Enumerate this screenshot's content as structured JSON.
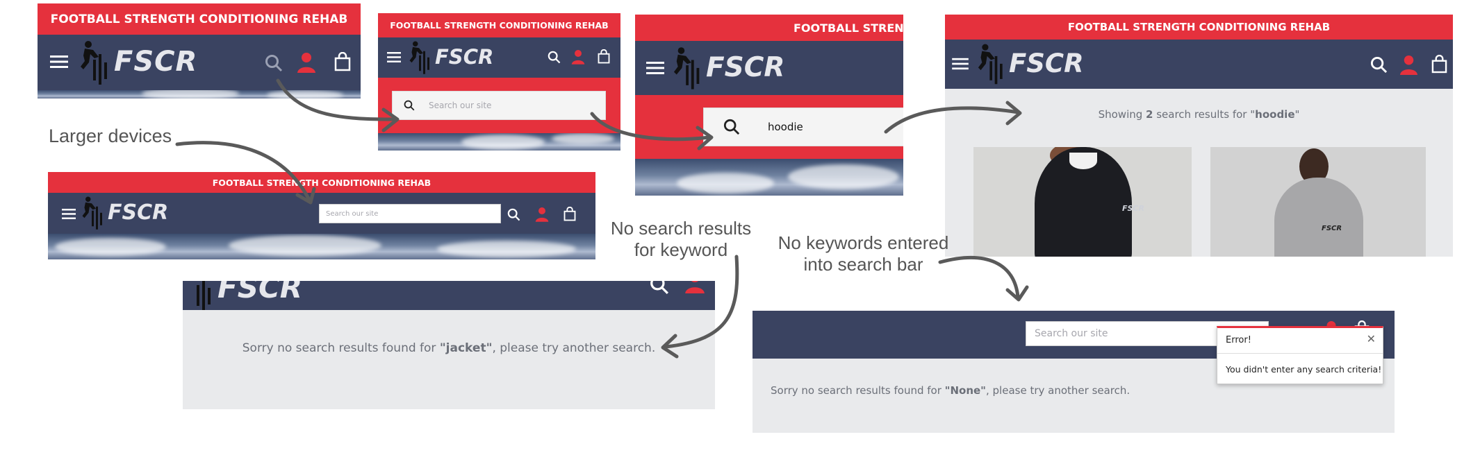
{
  "brand": {
    "banner_text": "FOOTBALL STRENGTH CONDITIONING REHAB",
    "logo_text": "FSCR",
    "colors": {
      "red": "#e5313d",
      "navy": "#3a4361",
      "grey_bg": "#e9eaec",
      "annotation": "#555555"
    }
  },
  "icons": [
    "menu-icon",
    "search-icon",
    "account-icon",
    "bag-icon"
  ],
  "annotations": {
    "larger_devices": "Larger devices",
    "no_results_line1": "No search results",
    "no_results_line2": "for keyword",
    "no_keywords_line1": "No keywords entered",
    "no_keywords_line2": "into search bar"
  },
  "search": {
    "placeholder": "Search our site",
    "typed_value": "hoodie"
  },
  "results": {
    "prefix": "Showing ",
    "count": "2",
    "middle": " search results for \"",
    "keyword": "hoodie",
    "suffix": "\""
  },
  "no_results_jacket": {
    "prefix": "Sorry no search results found for ",
    "keyword": "\"jacket\"",
    "suffix": ", please try another search."
  },
  "no_results_none": {
    "prefix": "Sorry no search results found for ",
    "keyword": "\"None\"",
    "suffix": ", please try another search."
  },
  "error_popup": {
    "title": "Error!",
    "close": "✕",
    "message": "You didn't enter any search criteria!"
  }
}
